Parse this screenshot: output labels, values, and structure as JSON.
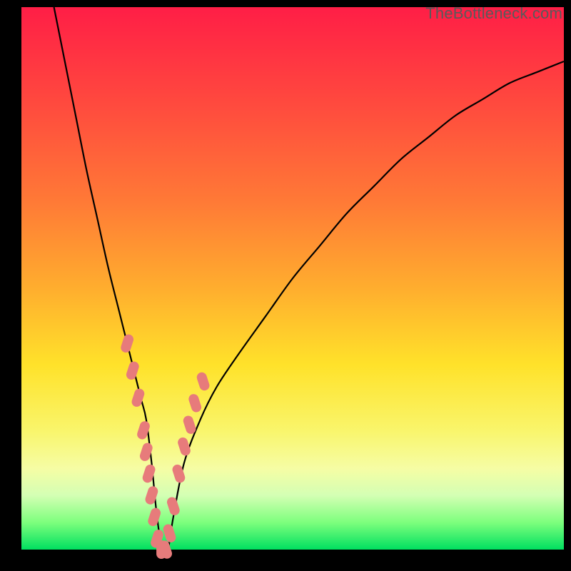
{
  "watermark": "TheBottleneck.com",
  "chart_data": {
    "type": "line",
    "title": "",
    "xlabel": "",
    "ylabel": "",
    "xlim": [
      0,
      100
    ],
    "ylim": [
      0,
      100
    ],
    "series": [
      {
        "name": "curve",
        "x": [
          6,
          8,
          10,
          12,
          14,
          16,
          18,
          20,
          22,
          23,
          24,
          25,
          26,
          27,
          28,
          30,
          33,
          36,
          40,
          45,
          50,
          55,
          60,
          65,
          70,
          75,
          80,
          85,
          90,
          95,
          100
        ],
        "values": [
          100,
          90,
          80,
          70,
          61,
          52,
          44,
          36,
          28,
          24,
          16,
          6,
          0,
          0,
          6,
          16,
          24,
          30,
          36,
          43,
          50,
          56,
          62,
          67,
          72,
          76,
          80,
          83,
          86,
          88,
          90
        ]
      }
    ],
    "markers": {
      "name": "highlighted-points",
      "color": "#e77b7b",
      "points": [
        {
          "x": 19.5,
          "y": 38
        },
        {
          "x": 20.5,
          "y": 33
        },
        {
          "x": 21.5,
          "y": 28
        },
        {
          "x": 22.5,
          "y": 22
        },
        {
          "x": 23.0,
          "y": 18
        },
        {
          "x": 23.5,
          "y": 14
        },
        {
          "x": 24.0,
          "y": 10
        },
        {
          "x": 24.5,
          "y": 6
        },
        {
          "x": 25.0,
          "y": 2
        },
        {
          "x": 25.8,
          "y": 0
        },
        {
          "x": 26.6,
          "y": 0
        },
        {
          "x": 27.3,
          "y": 3
        },
        {
          "x": 28.0,
          "y": 8
        },
        {
          "x": 29.0,
          "y": 14
        },
        {
          "x": 30.0,
          "y": 19
        },
        {
          "x": 31.0,
          "y": 23
        },
        {
          "x": 32.0,
          "y": 27
        },
        {
          "x": 33.5,
          "y": 31
        }
      ]
    }
  }
}
